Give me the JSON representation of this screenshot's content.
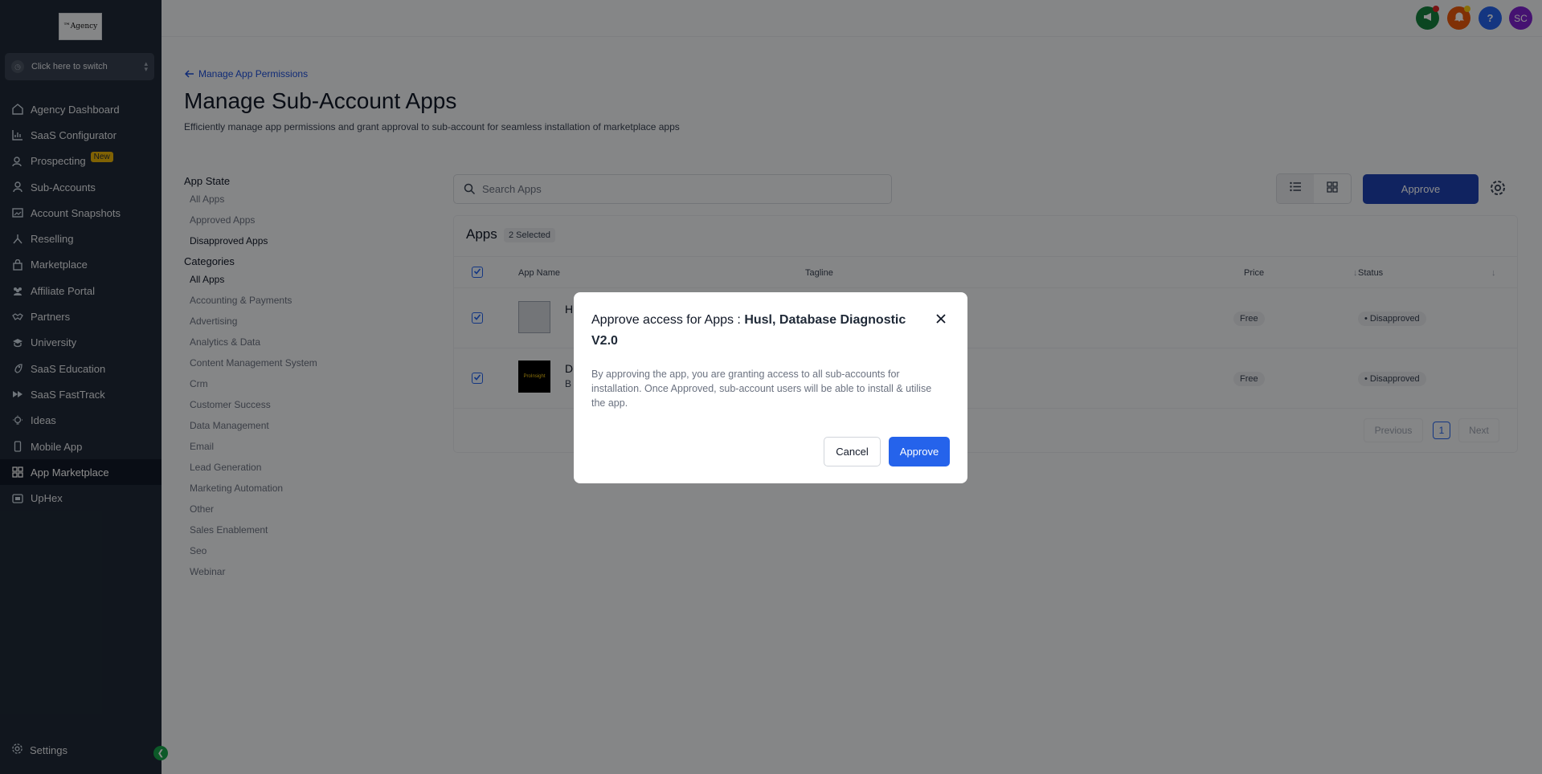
{
  "sidebar": {
    "logo_text": "™Agency",
    "switcher_label": "Click here to switch",
    "items": [
      {
        "label": "Agency Dashboard",
        "icon": "home-icon"
      },
      {
        "label": "SaaS Configurator",
        "icon": "chart-icon"
      },
      {
        "label": "Prospecting",
        "icon": "search-user-icon",
        "badge": "New"
      },
      {
        "label": "Sub-Accounts",
        "icon": "user-icon"
      },
      {
        "label": "Account Snapshots",
        "icon": "snapshot-icon"
      },
      {
        "label": "Reselling",
        "icon": "network-icon"
      },
      {
        "label": "Marketplace",
        "icon": "bag-icon"
      },
      {
        "label": "Affiliate Portal",
        "icon": "users-icon"
      },
      {
        "label": "Partners",
        "icon": "handshake-icon"
      },
      {
        "label": "University",
        "icon": "graduation-icon"
      },
      {
        "label": "SaaS Education",
        "icon": "rocket-icon"
      },
      {
        "label": "SaaS FastTrack",
        "icon": "fast-forward-icon"
      },
      {
        "label": "Ideas",
        "icon": "lightbulb-icon"
      },
      {
        "label": "Mobile App",
        "icon": "phone-icon"
      },
      {
        "label": "App Marketplace",
        "icon": "grid-icon"
      },
      {
        "label": "UpHex",
        "icon": "uphex-icon"
      }
    ],
    "settings_label": "Settings"
  },
  "topbar": {
    "avatar_initials": "SC",
    "help_glyph": "?"
  },
  "page": {
    "back_link": "Manage App Permissions",
    "title": "Manage Sub-Account Apps",
    "subtitle": "Efficiently manage app permissions and grant approval to sub-account for seamless installation of marketplace apps"
  },
  "filters": {
    "state_heading": "App State",
    "state_items": [
      "All Apps",
      "Approved Apps",
      "Disapproved Apps"
    ],
    "categories_heading": "Categories",
    "category_items": [
      "All Apps",
      "Accounting & Payments",
      "Advertising",
      "Analytics & Data",
      "Content Management System",
      "Crm",
      "Customer Success",
      "Data Management",
      "Email",
      "Lead Generation",
      "Marketing Automation",
      "Other",
      "Sales Enablement",
      "Seo",
      "Webinar"
    ]
  },
  "search": {
    "placeholder": "Search Apps"
  },
  "toolbar": {
    "approve_label": "Approve"
  },
  "table": {
    "title": "Apps",
    "selected_badge": "2 Selected",
    "columns": {
      "app_name": "App Name",
      "tagline": "Tagline",
      "price": "Price",
      "status": "Status"
    },
    "rows": [
      {
        "name_initial": "H",
        "sub_initial": "",
        "price": "Free",
        "status": "Disapproved"
      },
      {
        "name_initial": "D",
        "sub_initial": "B",
        "thumb_text": "ProInsight",
        "price": "Free",
        "status": "Disapproved"
      }
    ],
    "pagination": {
      "previous": "Previous",
      "page": "1",
      "next": "Next"
    }
  },
  "modal": {
    "title_prefix": "Approve access for Apps : ",
    "title_apps": "Husl, Database Diagnostic V2.0",
    "body": "By approving the app, you are granting access to all sub-accounts for installation. Once Approved, sub-account users will be able to install & utilise the app.",
    "cancel_label": "Cancel",
    "approve_label": "Approve"
  },
  "colors": {
    "sidebar_bg": "#1f2937",
    "primary": "#2563eb",
    "announce": "#15803d",
    "bell": "#ea580c",
    "help": "#2563eb",
    "avatar": "#7e22ce"
  }
}
